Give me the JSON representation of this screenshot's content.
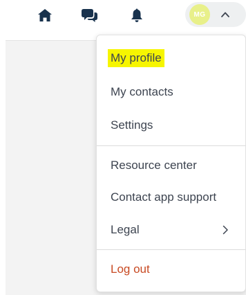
{
  "topbar": {
    "home_icon": "home-icon",
    "chat_icon": "chat-icon",
    "bell_icon": "bell-icon"
  },
  "user_menu": {
    "initials": "MG",
    "avatar_color": "#e8f08a",
    "expanded": true
  },
  "dropdown": {
    "items": [
      {
        "label": "My profile",
        "highlighted": true
      },
      {
        "label": "My contacts"
      },
      {
        "label": "Settings"
      },
      {
        "label": "Resource center"
      },
      {
        "label": "Contact app support"
      },
      {
        "label": "Legal",
        "has_submenu": true
      },
      {
        "label": "Log out"
      }
    ]
  },
  "colors": {
    "icon": "#18324d",
    "highlight": "#f6f500",
    "logout": "#c84a23",
    "text": "#3d4450"
  }
}
